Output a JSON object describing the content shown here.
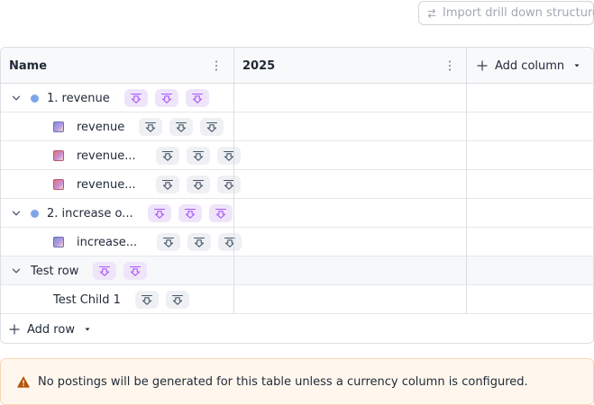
{
  "toolbar": {
    "import_label": "Import drill down structure",
    "import_icon": "swap-arrows-icon"
  },
  "table": {
    "headers": {
      "name": "Name",
      "year": "2025",
      "add_column": "Add column"
    },
    "rows": [
      {
        "label": "1. revenue",
        "level": 0,
        "expandable": true,
        "marker": "dot",
        "chips": 3,
        "chip_style": "purple"
      },
      {
        "label": "revenue",
        "level": 1,
        "expandable": false,
        "marker": "thumb-blue",
        "chips": 3,
        "chip_style": "gray"
      },
      {
        "label": "revenue...",
        "level": 1,
        "expandable": false,
        "marker": "thumb-red",
        "chips": 3,
        "chip_style": "gray"
      },
      {
        "label": "revenue...",
        "level": 1,
        "expandable": false,
        "marker": "thumb-red",
        "chips": 3,
        "chip_style": "gray"
      },
      {
        "label": "2. increase o...",
        "level": 0,
        "expandable": true,
        "marker": "dot",
        "chips": 3,
        "chip_style": "purple"
      },
      {
        "label": "increase...",
        "level": 1,
        "expandable": false,
        "marker": "thumb-blue",
        "chips": 3,
        "chip_style": "gray"
      },
      {
        "label": "Test row",
        "level": 0,
        "expandable": true,
        "marker": "none",
        "chips": 2,
        "chip_style": "purple",
        "shaded": true
      },
      {
        "label": "Test Child 1",
        "level": 1,
        "expandable": false,
        "marker": "none",
        "chips": 2,
        "chip_style": "gray"
      }
    ],
    "add_row": "Add row"
  },
  "warning": {
    "text": "No postings will be generated for this table unless a currency column is configured.",
    "icon": "warning-triangle-icon",
    "accent": "#b45309"
  },
  "colors": {
    "purple_chip": "#efe5fb",
    "purple_arrow": "#a855f7",
    "gray_chip": "#eef0f3",
    "gray_arrow": "#475569",
    "dot": "#7ea5e8"
  }
}
